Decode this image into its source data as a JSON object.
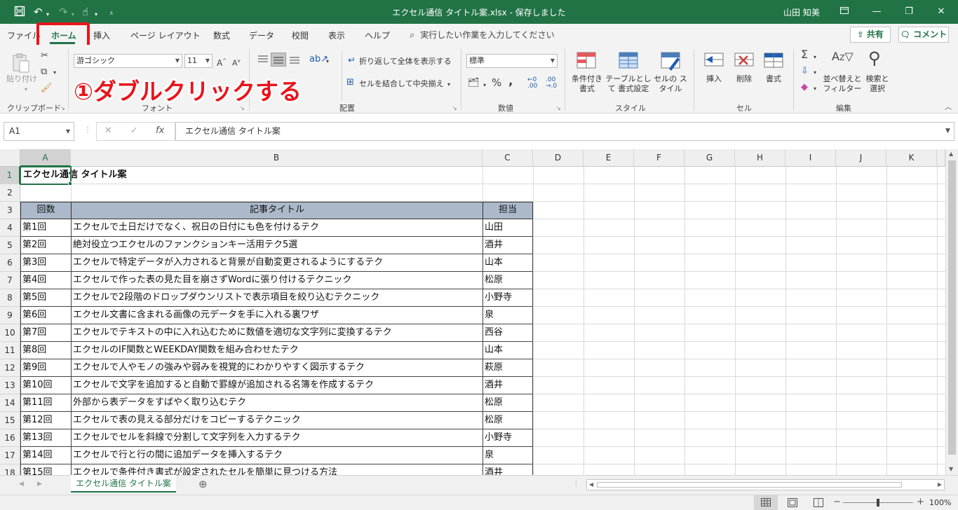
{
  "titlebar": {
    "title": "エクセル通信 タイトル案.xlsx  -  保存しました",
    "user": "山田 知美",
    "bg_color": "#217346"
  },
  "qat": {
    "save_icon": "save-icon",
    "undo_icon": "undo-icon",
    "redo_icon": "redo-icon",
    "touch_icon": "touch-mode-icon",
    "customize_icon": "customize-qat-icon"
  },
  "tabs": [
    "ファイル",
    "ホーム",
    "挿入",
    "ページ レイアウト",
    "数式",
    "データ",
    "校閲",
    "表示",
    "ヘルプ"
  ],
  "active_tab": "ホーム",
  "tell_me": "実行したい作業を入力してください",
  "share_label": "共有",
  "comment_label": "コメント",
  "ribbon": {
    "clipboard": {
      "paste_label": "貼り付け",
      "group_label": "クリップボード"
    },
    "font": {
      "font_name": "游ゴシック",
      "font_size": "11",
      "group_label": "フォント"
    },
    "alignment": {
      "wrap_label": "折り返して全体を表示する",
      "merge_label": "セルを結合して中央揃え",
      "group_label": "配置"
    },
    "number": {
      "format": "標準",
      "group_label": "数値"
    },
    "styles": {
      "conditional_label": "条件付き 書式",
      "table_label": "テーブルとして 書式設定",
      "cell_styles_label": "セルの スタイル",
      "group_label": "スタイル"
    },
    "cells": {
      "insert_label": "挿入",
      "delete_label": "削除",
      "format_label": "書式",
      "group_label": "セル"
    },
    "editing": {
      "sort_label": "並べ替えと フィルター",
      "find_label": "検索と 選択",
      "group_label": "編集"
    }
  },
  "annotation": "①ダブルクリックする",
  "annotation_color": "#e8141c",
  "formula_bar": {
    "name_box": "A1",
    "content": "エクセル通信 タイトル案"
  },
  "columns": [
    "A",
    "B",
    "C",
    "D",
    "E",
    "F",
    "G",
    "H",
    "I",
    "J",
    "K"
  ],
  "rows": [
    "1",
    "2",
    "3",
    "4",
    "5",
    "6",
    "7",
    "8",
    "9",
    "10",
    "11",
    "12",
    "13",
    "14",
    "15",
    "16",
    "17",
    "18"
  ],
  "sheet_title": "エクセル通信 タイトル案",
  "table_headers": {
    "number": "回数",
    "title": "記事タイトル",
    "owner": "担当"
  },
  "table_header_color": "#acb9ca",
  "table_rows": [
    {
      "no": "第1回",
      "title": "エクセルで土日だけでなく、祝日の日付にも色を付けるテク",
      "owner": "山田"
    },
    {
      "no": "第2回",
      "title": "絶対役立つエクセルのファンクションキー活用テク5選",
      "owner": "酒井"
    },
    {
      "no": "第3回",
      "title": "エクセルで特定データが入力されると背景が自動変更されるようにするテク",
      "owner": "山本"
    },
    {
      "no": "第4回",
      "title": "エクセルで作った表の見た目を崩さずWordに張り付けるテクニック",
      "owner": "松原"
    },
    {
      "no": "第5回",
      "title": "エクセルで2段階のドロップダウンリストで表示項目を絞り込むテクニック",
      "owner": "小野寺"
    },
    {
      "no": "第6回",
      "title": "エクセル文書に含まれる画像の元データを手に入れる裏ワザ",
      "owner": "泉"
    },
    {
      "no": "第7回",
      "title": "エクセルでテキストの中に入れ込むために数値を適切な文字列に変換するテク",
      "owner": "西谷"
    },
    {
      "no": "第8回",
      "title": "エクセルのIF関数とWEEKDAY関数を組み合わせたテク",
      "owner": "山本"
    },
    {
      "no": "第9回",
      "title": "エクセルで人やモノの強みや弱みを視覚的にわかりやすく図示するテク",
      "owner": "萩原"
    },
    {
      "no": "第10回",
      "title": "エクセルで文字を追加すると自動で罫線が追加される名簿を作成するテク",
      "owner": "酒井"
    },
    {
      "no": "第11回",
      "title": "外部から表データをすばやく取り込むテク",
      "owner": "松原"
    },
    {
      "no": "第12回",
      "title": "エクセルで表の見える部分だけをコピーするテクニック",
      "owner": "松原"
    },
    {
      "no": "第13回",
      "title": "エクセルでセルを斜線で分割して文字列を入力するテク",
      "owner": "小野寺"
    },
    {
      "no": "第14回",
      "title": "エクセルで行と行の間に追加データを挿入するテク",
      "owner": "泉"
    },
    {
      "no": "第15回",
      "title": "エクセルで条件付き書式が設定されたセルを簡単に見つける方法",
      "owner": "酒井"
    }
  ],
  "status": {
    "zoom": "100%"
  }
}
